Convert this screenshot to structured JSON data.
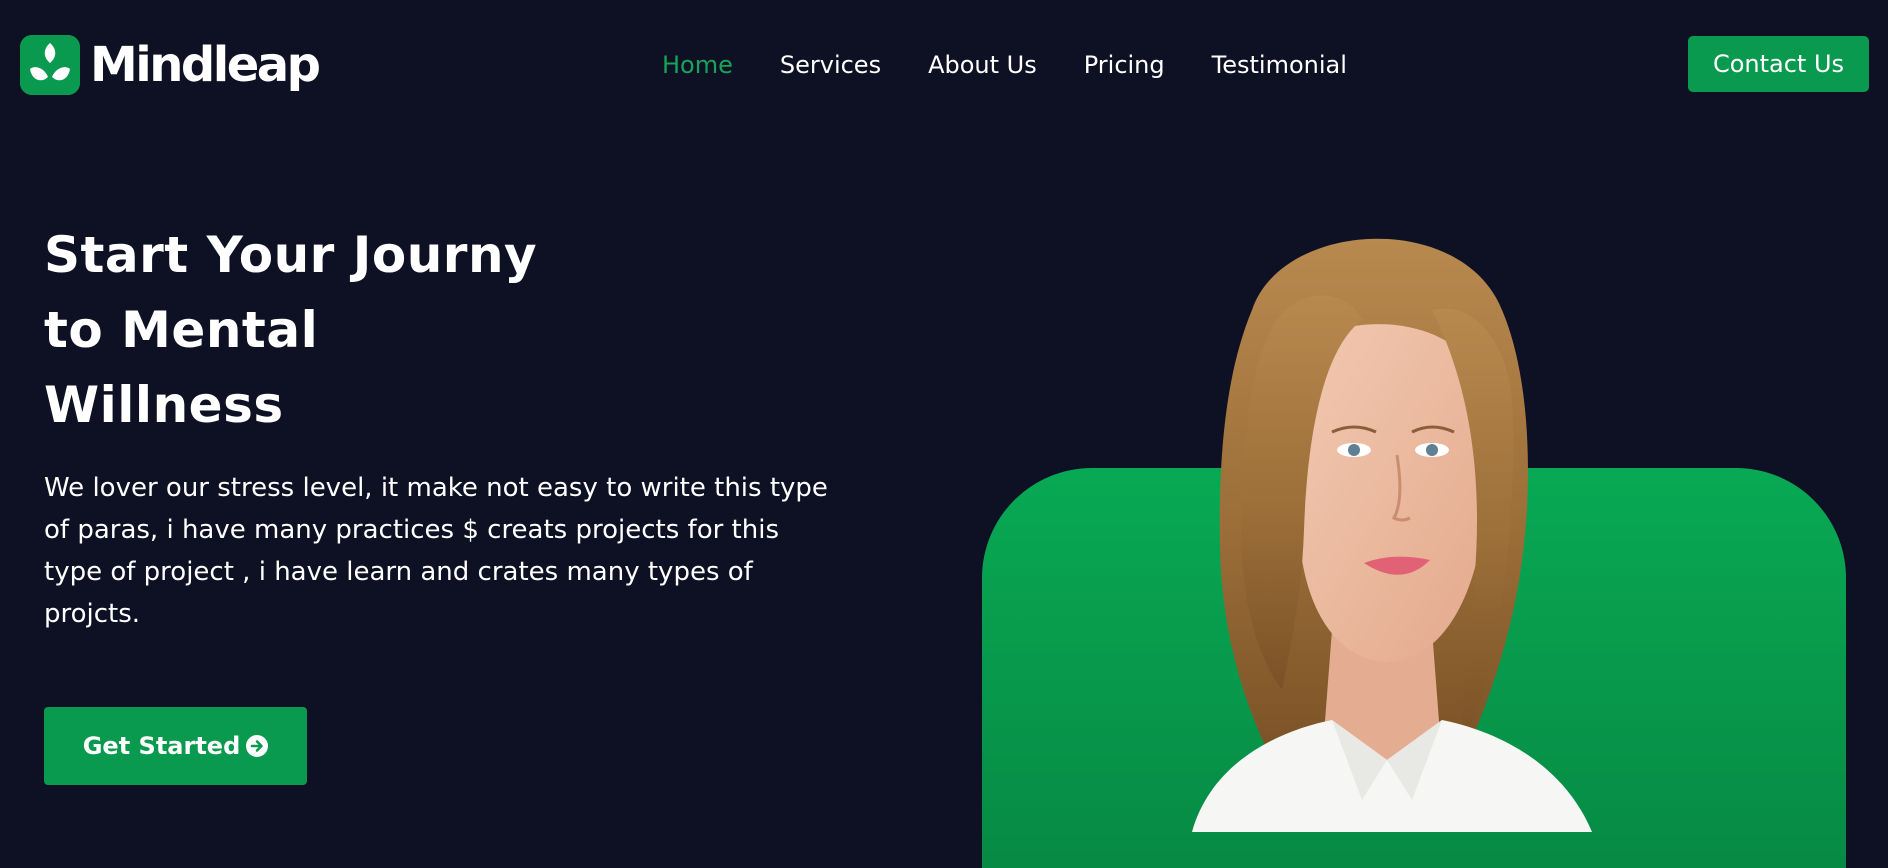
{
  "brand": {
    "name": "Mindleap",
    "logo_icon": "leaf-sprout-icon",
    "accent_color": "#0a9a4f",
    "background_color": "#0e1124"
  },
  "nav": {
    "items": [
      {
        "label": "Home",
        "active": true
      },
      {
        "label": "Services",
        "active": false
      },
      {
        "label": "About Us",
        "active": false
      },
      {
        "label": "Pricing",
        "active": false
      },
      {
        "label": "Testimonial",
        "active": false
      }
    ],
    "contact_label": "Contact Us"
  },
  "hero": {
    "title_lines": [
      "Start Your Journy",
      "to Mental",
      "Willness"
    ],
    "description": "We lover our stress level, it make not easy to write this type of paras, i have many practices $ creats projects for this type of project , i have learn and crates many types of projcts.",
    "cta_label": "Get Started",
    "cta_icon": "arrow-circle-right-icon"
  },
  "visual": {
    "image": "portrait-woman"
  }
}
